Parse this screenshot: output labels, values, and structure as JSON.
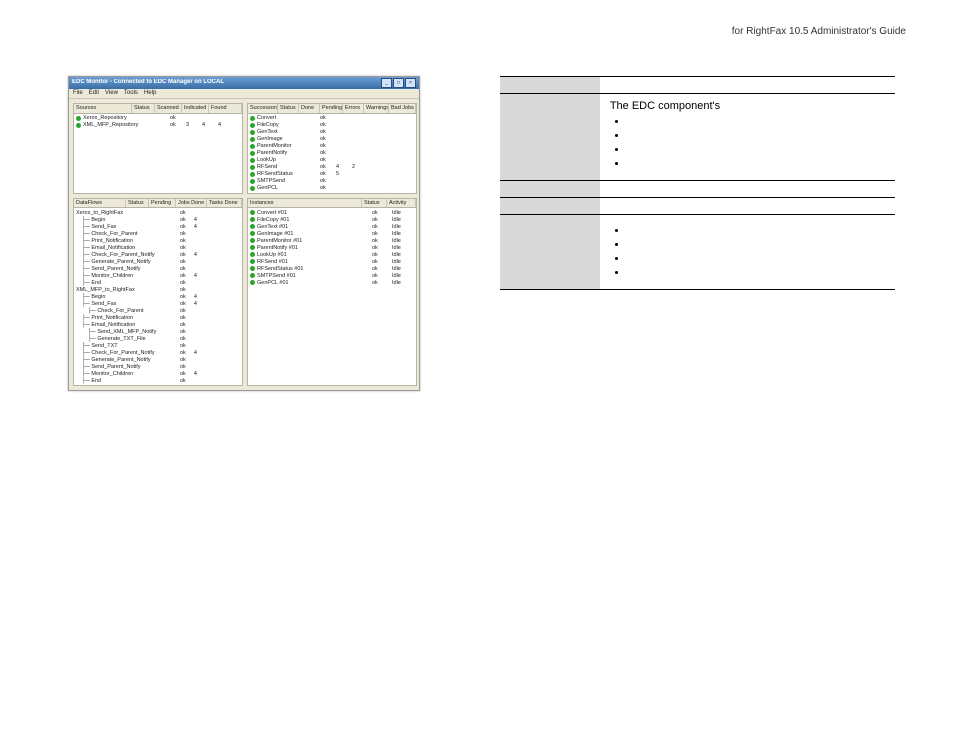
{
  "header": {
    "line": "for RightFax 10.5 Administrator's Guide"
  },
  "footer": {
    "page": ""
  },
  "shot": {
    "title": "EDC Monitor - Connected to EDC Manager on LOCAL",
    "menu": [
      "File",
      "Edit",
      "View",
      "Tools",
      "Help"
    ],
    "sources": {
      "cols": [
        "Sources",
        "Status",
        "Scanned",
        "Indicated",
        "Found"
      ],
      "rows": [
        {
          "name": "Xerox_Repository",
          "status": "ok",
          "scanned": "",
          "ind": "",
          "found": ""
        },
        {
          "name": "XML_MFP_Repository",
          "status": "ok",
          "scanned": "3",
          "ind": "4",
          "found": "4"
        }
      ]
    },
    "successors": {
      "cols": [
        "Successors",
        "Status",
        "Done",
        "Pending",
        "Errors",
        "Warnings",
        "Bad Jobs"
      ],
      "rows": [
        {
          "name": "Convert",
          "status": "ok"
        },
        {
          "name": "FileCopy",
          "status": "ok"
        },
        {
          "name": "GenText",
          "status": "ok"
        },
        {
          "name": "GenImage",
          "status": "ok"
        },
        {
          "name": "ParentMonitor",
          "status": "ok"
        },
        {
          "name": "ParentNotify",
          "status": "ok"
        },
        {
          "name": "LookUp",
          "status": "ok"
        },
        {
          "name": "RFSend",
          "status": "ok",
          "done": "4",
          "pending": "2"
        },
        {
          "name": "RFSendStatus",
          "status": "ok",
          "done": "5"
        },
        {
          "name": "SMTPSend",
          "status": "ok"
        },
        {
          "name": "GenPCL",
          "status": "ok"
        }
      ]
    },
    "dataflows": {
      "cols": [
        "DataFlows",
        "Status",
        "Pending",
        "Jobs Done",
        "Tasks Done"
      ],
      "tree": [
        {
          "ind": 0,
          "name": "Xerox_to_RightFax",
          "status": "ok",
          "p": "",
          "jd": "",
          "td": ""
        },
        {
          "ind": 1,
          "name": "Begin",
          "status": "ok",
          "jd": "4"
        },
        {
          "ind": 1,
          "name": "Send_Fax",
          "status": "ok",
          "jd": "4"
        },
        {
          "ind": 1,
          "name": "Check_For_Parent",
          "status": "ok"
        },
        {
          "ind": 1,
          "name": "Print_Notification",
          "status": "ok"
        },
        {
          "ind": 1,
          "name": "Email_Notification",
          "status": "ok"
        },
        {
          "ind": 1,
          "name": "Check_For_Parent_Notify",
          "status": "ok",
          "jd": "4"
        },
        {
          "ind": 1,
          "name": "Generate_Parent_Notify",
          "status": "ok"
        },
        {
          "ind": 1,
          "name": "Send_Parent_Notify",
          "status": "ok"
        },
        {
          "ind": 1,
          "name": "Monitor_Children",
          "status": "ok",
          "jd": "4"
        },
        {
          "ind": 1,
          "name": "End",
          "status": "ok"
        },
        {
          "ind": 0,
          "name": "XML_MFP_to_RightFax",
          "status": "ok"
        },
        {
          "ind": 1,
          "name": "Begin",
          "status": "ok",
          "jd": "4"
        },
        {
          "ind": 1,
          "name": "Send_Fax",
          "status": "ok",
          "jd": "4"
        },
        {
          "ind": 2,
          "name": "Check_For_Parent",
          "status": "ok"
        },
        {
          "ind": 1,
          "name": "Print_Notification",
          "status": "ok"
        },
        {
          "ind": 1,
          "name": "Email_Notification",
          "status": "ok"
        },
        {
          "ind": 2,
          "name": "Send_XML_MFP_Notify",
          "status": "ok"
        },
        {
          "ind": 2,
          "name": "Generate_TXT_File",
          "status": "ok"
        },
        {
          "ind": 1,
          "name": "Send_TXT",
          "status": "ok"
        },
        {
          "ind": 1,
          "name": "Check_For_Parent_Notify",
          "status": "ok",
          "jd": "4"
        },
        {
          "ind": 1,
          "name": "Generate_Parent_Notify",
          "status": "ok"
        },
        {
          "ind": 1,
          "name": "Send_Parent_Notify",
          "status": "ok"
        },
        {
          "ind": 1,
          "name": "Monitor_Children",
          "status": "ok",
          "jd": "4"
        },
        {
          "ind": 1,
          "name": "End",
          "status": "ok"
        }
      ]
    },
    "instances": {
      "cols": [
        "Instances",
        "Status",
        "Activity"
      ],
      "rows": [
        {
          "name": "Convert #01",
          "status": "ok",
          "act": "Idle"
        },
        {
          "name": "FileCopy #01",
          "status": "ok",
          "act": "Idle"
        },
        {
          "name": "GenText #01",
          "status": "ok",
          "act": "Idle"
        },
        {
          "name": "GenImage #01",
          "status": "ok",
          "act": "Idle"
        },
        {
          "name": "ParentMonitor #01",
          "status": "ok",
          "act": "Idle"
        },
        {
          "name": "ParentNotify #01",
          "status": "ok",
          "act": "Idle"
        },
        {
          "name": "LookUp #01",
          "status": "ok",
          "act": "Idle"
        },
        {
          "name": "RFSend #01",
          "status": "ok",
          "act": "Idle"
        },
        {
          "name": "RFSendStatus #01",
          "status": "ok",
          "act": "Idle"
        },
        {
          "name": "SMTPSend #01",
          "status": "ok",
          "act": "Idle"
        },
        {
          "name": "GenPCL #01",
          "status": "ok",
          "act": "Idle"
        }
      ]
    }
  },
  "doc": {
    "table": {
      "headers": [
        "",
        ""
      ],
      "rows": [
        {
          "name": "",
          "lead": "The EDC component's",
          "bullets": [
            "",
            "",
            "",
            ""
          ]
        },
        {
          "name": "",
          "desc": ""
        },
        {
          "name": "",
          "desc": ""
        },
        {
          "name": "",
          "lead": "",
          "bullets": [
            "",
            "",
            "",
            ""
          ]
        }
      ]
    }
  }
}
